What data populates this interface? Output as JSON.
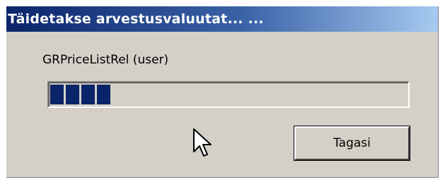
{
  "dialog": {
    "title": "Täidetakse arvestusvaluutat... ...",
    "task_label": "GRPriceListRel (user)",
    "progress": {
      "filled_blocks": 4,
      "value_fraction": 0.18,
      "fill_color": "#0a246a"
    },
    "cancel_button_label": "Tagasi"
  },
  "colors": {
    "title_bar_start": "#0a246a",
    "title_bar_end": "#a6caf0",
    "dialog_background": "#d4d0c8"
  },
  "icons": {
    "cursor": "arrow-pointer-icon"
  }
}
